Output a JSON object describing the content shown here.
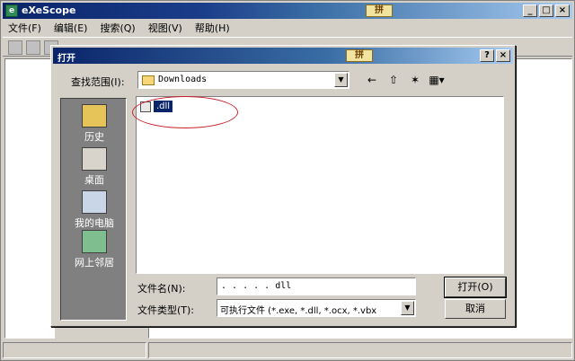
{
  "app": {
    "title": "eXeScope",
    "badge": "拼",
    "icon_glyph": "e",
    "caption": {
      "minimize": "_",
      "maximize": "□",
      "close": "×"
    }
  },
  "menu": [
    {
      "label": "文件(F)"
    },
    {
      "label": "编辑(E)"
    },
    {
      "label": "搜索(Q)"
    },
    {
      "label": "视图(V)"
    },
    {
      "label": "帮助(H)"
    }
  ],
  "dialog": {
    "title": "打开",
    "badge": "拼",
    "caption": {
      "help": "?",
      "close": "×"
    },
    "look_in_label": "查找范围(I):",
    "look_in_value": "Downloads",
    "dropdown_glyph": "▼",
    "nav": {
      "back": "←",
      "up": "⇧",
      "new_folder": "✶",
      "view_menu": "▦▾"
    },
    "places": [
      {
        "label": "历史",
        "icon": "history-icon"
      },
      {
        "label": "桌面",
        "icon": "desktop-icon"
      },
      {
        "label": "我的电脑",
        "icon": "my-computer-icon"
      },
      {
        "label": "网上邻居",
        "icon": "network-places-icon"
      }
    ],
    "files": [
      {
        "name": "        .dll"
      }
    ],
    "file_name_label": "文件名(N):",
    "file_name_value": "  .  .  .  .  . dll",
    "file_type_label": "文件类型(T):",
    "file_type_value": "可执行文件 (*.exe, *.dll, *.ocx, *.vbx",
    "open_button": "打开(O)",
    "cancel_button": "取消"
  },
  "colors": {
    "selection": "#0a246a",
    "annotation_circle": "#c8202a"
  }
}
